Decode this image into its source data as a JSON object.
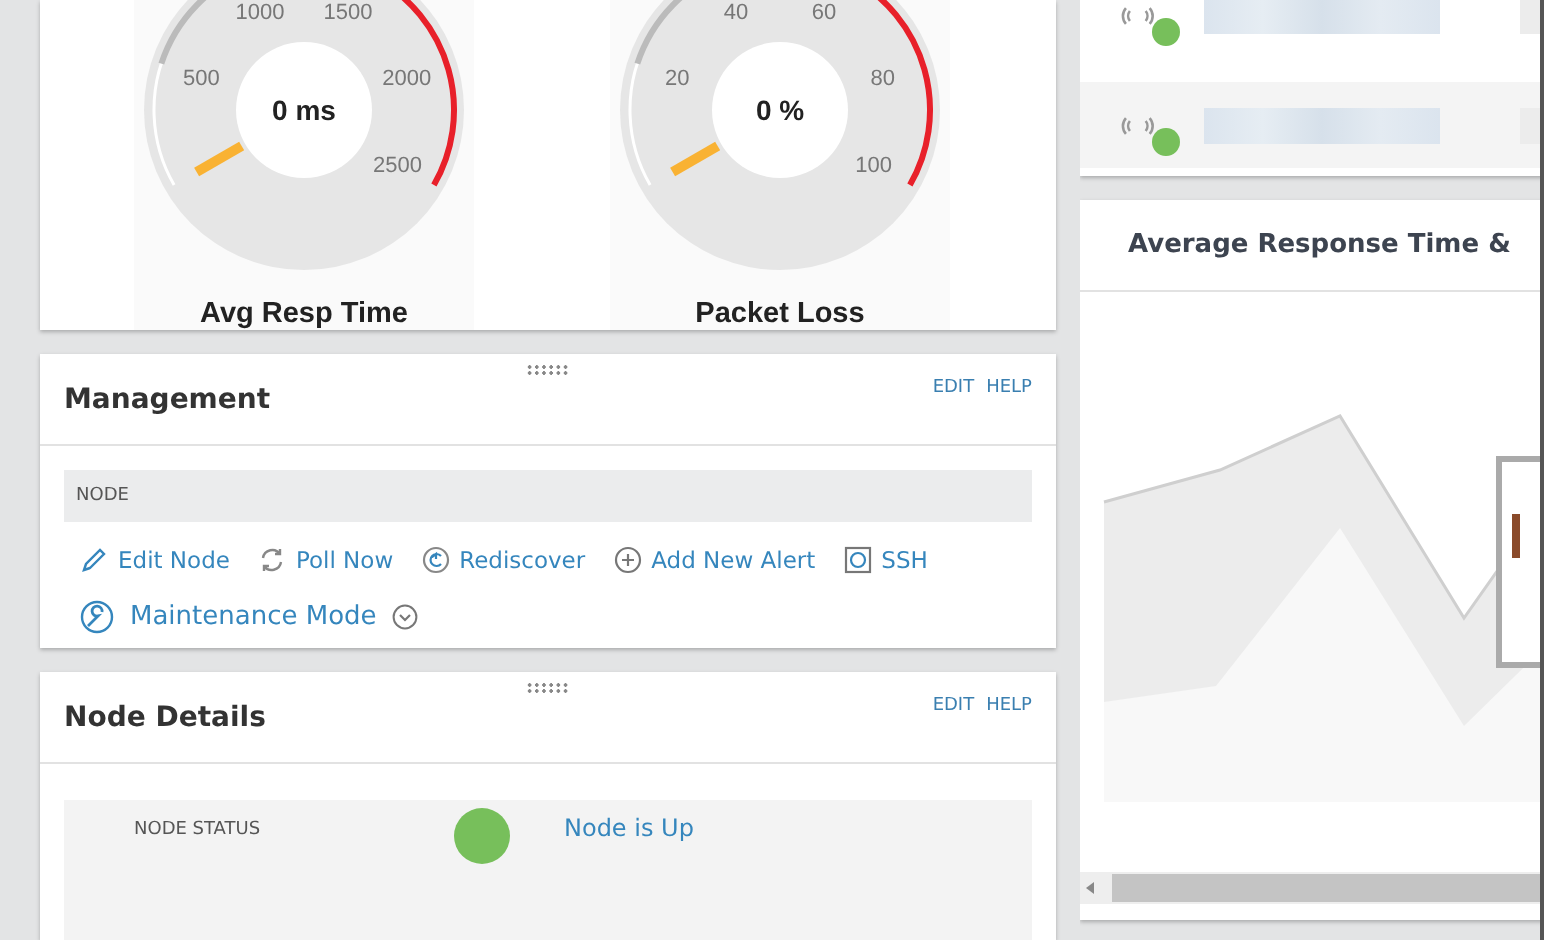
{
  "gauges": [
    {
      "label": "Avg Resp Time",
      "reading": "0 ms",
      "scale": [
        "500",
        "1000",
        "1500",
        "2000",
        "2500"
      ]
    },
    {
      "label": "Packet Loss",
      "reading": "0 %",
      "scale": [
        "20",
        "40",
        "60",
        "80",
        "100"
      ]
    }
  ],
  "management": {
    "title": "Management",
    "links": [
      "EDIT",
      "HELP"
    ],
    "section": "NODE",
    "actions": [
      {
        "kind": "edit",
        "label": "Edit Node"
      },
      {
        "kind": "poll",
        "label": "Poll Now"
      },
      {
        "kind": "rediscover",
        "label": "Rediscover"
      },
      {
        "kind": "add",
        "label": "Add New Alert"
      },
      {
        "kind": "ssh",
        "label": "SSH"
      }
    ],
    "maintenance": {
      "label": "Maintenance Mode",
      "expanded": false
    }
  },
  "node_details": {
    "title": "Node Details",
    "links": [
      "EDIT",
      "HELP"
    ],
    "status_label": "NODE STATUS",
    "status_value": "Node is Up",
    "color": "#77bf5b"
  },
  "devices": [
    {
      "color": "#77bf5b"
    },
    {
      "color": "#77bf5b"
    }
  ],
  "chart_panel": {
    "title": "Average Response Time &"
  }
}
